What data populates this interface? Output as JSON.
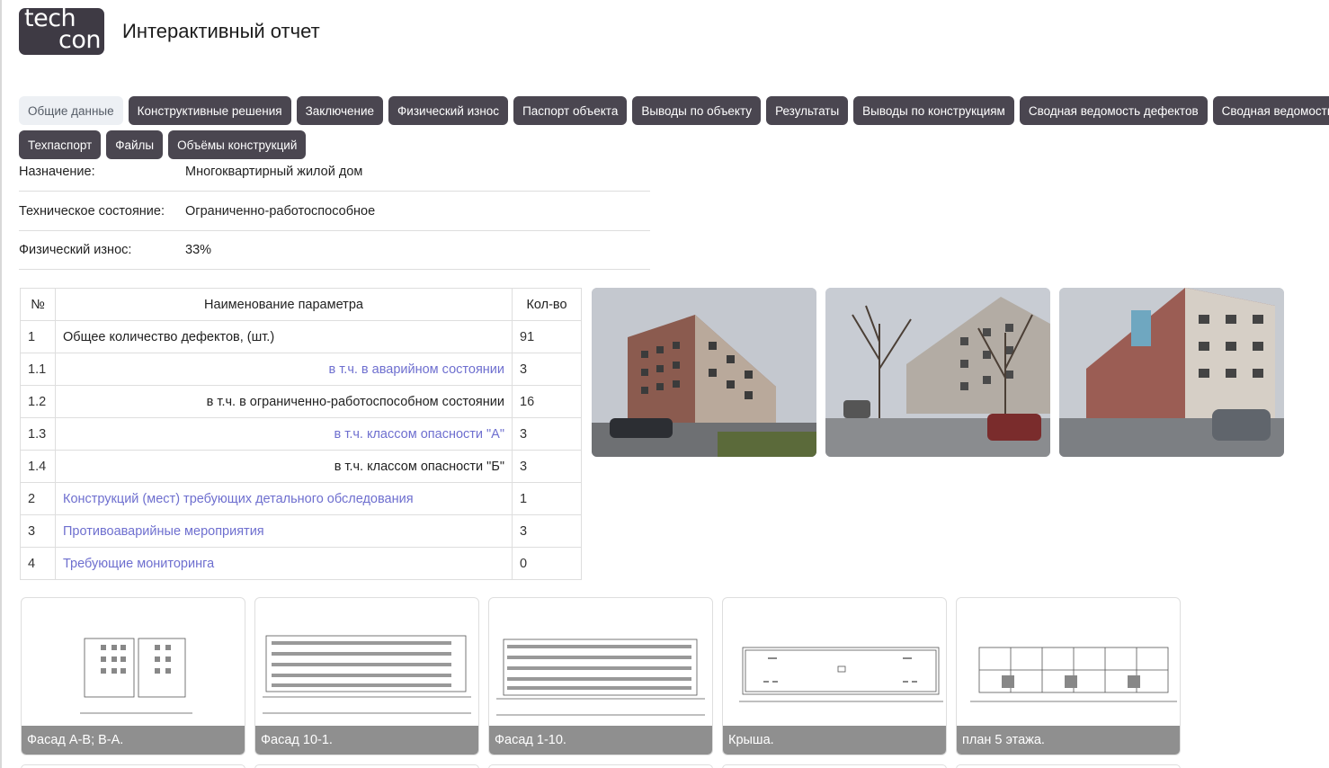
{
  "brand": {
    "logo_line1": "tech",
    "logo_line2": "con"
  },
  "header": {
    "title": "Интерактивный отчет"
  },
  "tabs": {
    "row1": [
      "Общие данные",
      "Конструктивные решения",
      "Заключение",
      "Физический износ",
      "Паспорт объекта",
      "Выводы по объекту",
      "Результаты",
      "Выводы по конструкциям",
      "Сводная ведомость дефектов",
      "Сводная ведомость"
    ],
    "row2": [
      "Техпаспорт",
      "Файлы",
      "Объёмы конструкций"
    ]
  },
  "info": {
    "purpose_label": "Назначение:",
    "purpose_value": "Многоквартирный жилой дом",
    "state_label": "Техническое состояние:",
    "state_value": "Ограниченно-работоспособное",
    "wear_label": "Физический износ:",
    "wear_value": "33%"
  },
  "params_table": {
    "headers": [
      "№",
      "Наименование параметра",
      "Кол-во"
    ],
    "rows": [
      {
        "n": "1",
        "name": "Общее количество дефектов, (шт.)",
        "qty": "91"
      },
      {
        "n": "1.1",
        "name": "в т.ч. в аварийном состоянии",
        "qty": "3"
      },
      {
        "n": "1.2",
        "name": "в т.ч. в ограниченно-работоспособном состоянии",
        "qty": "16"
      },
      {
        "n": "1.3",
        "name": "в т.ч. классом опасности \"А\"",
        "qty": "3"
      },
      {
        "n": "1.4",
        "name": "в т.ч. классом опасности \"Б\"",
        "qty": "3"
      },
      {
        "n": "2",
        "name": "Конструкций (мест) требующих детального обследования",
        "qty": "1"
      },
      {
        "n": "3",
        "name": "Противоаварийные мероприятия",
        "qty": "3"
      },
      {
        "n": "4",
        "name": "Требующие мониторинга",
        "qty": "0"
      }
    ]
  },
  "drawings": [
    "Фасад А-В; В-А.",
    "Фасад 10-1.",
    "Фасад 1-10.",
    "Крыша.",
    "план 5 этажа."
  ],
  "colors": {
    "tab": "#4a4650",
    "tab_active": "#edf0f4",
    "link": "#6e6fcf",
    "caption": "#8f8f8f"
  }
}
